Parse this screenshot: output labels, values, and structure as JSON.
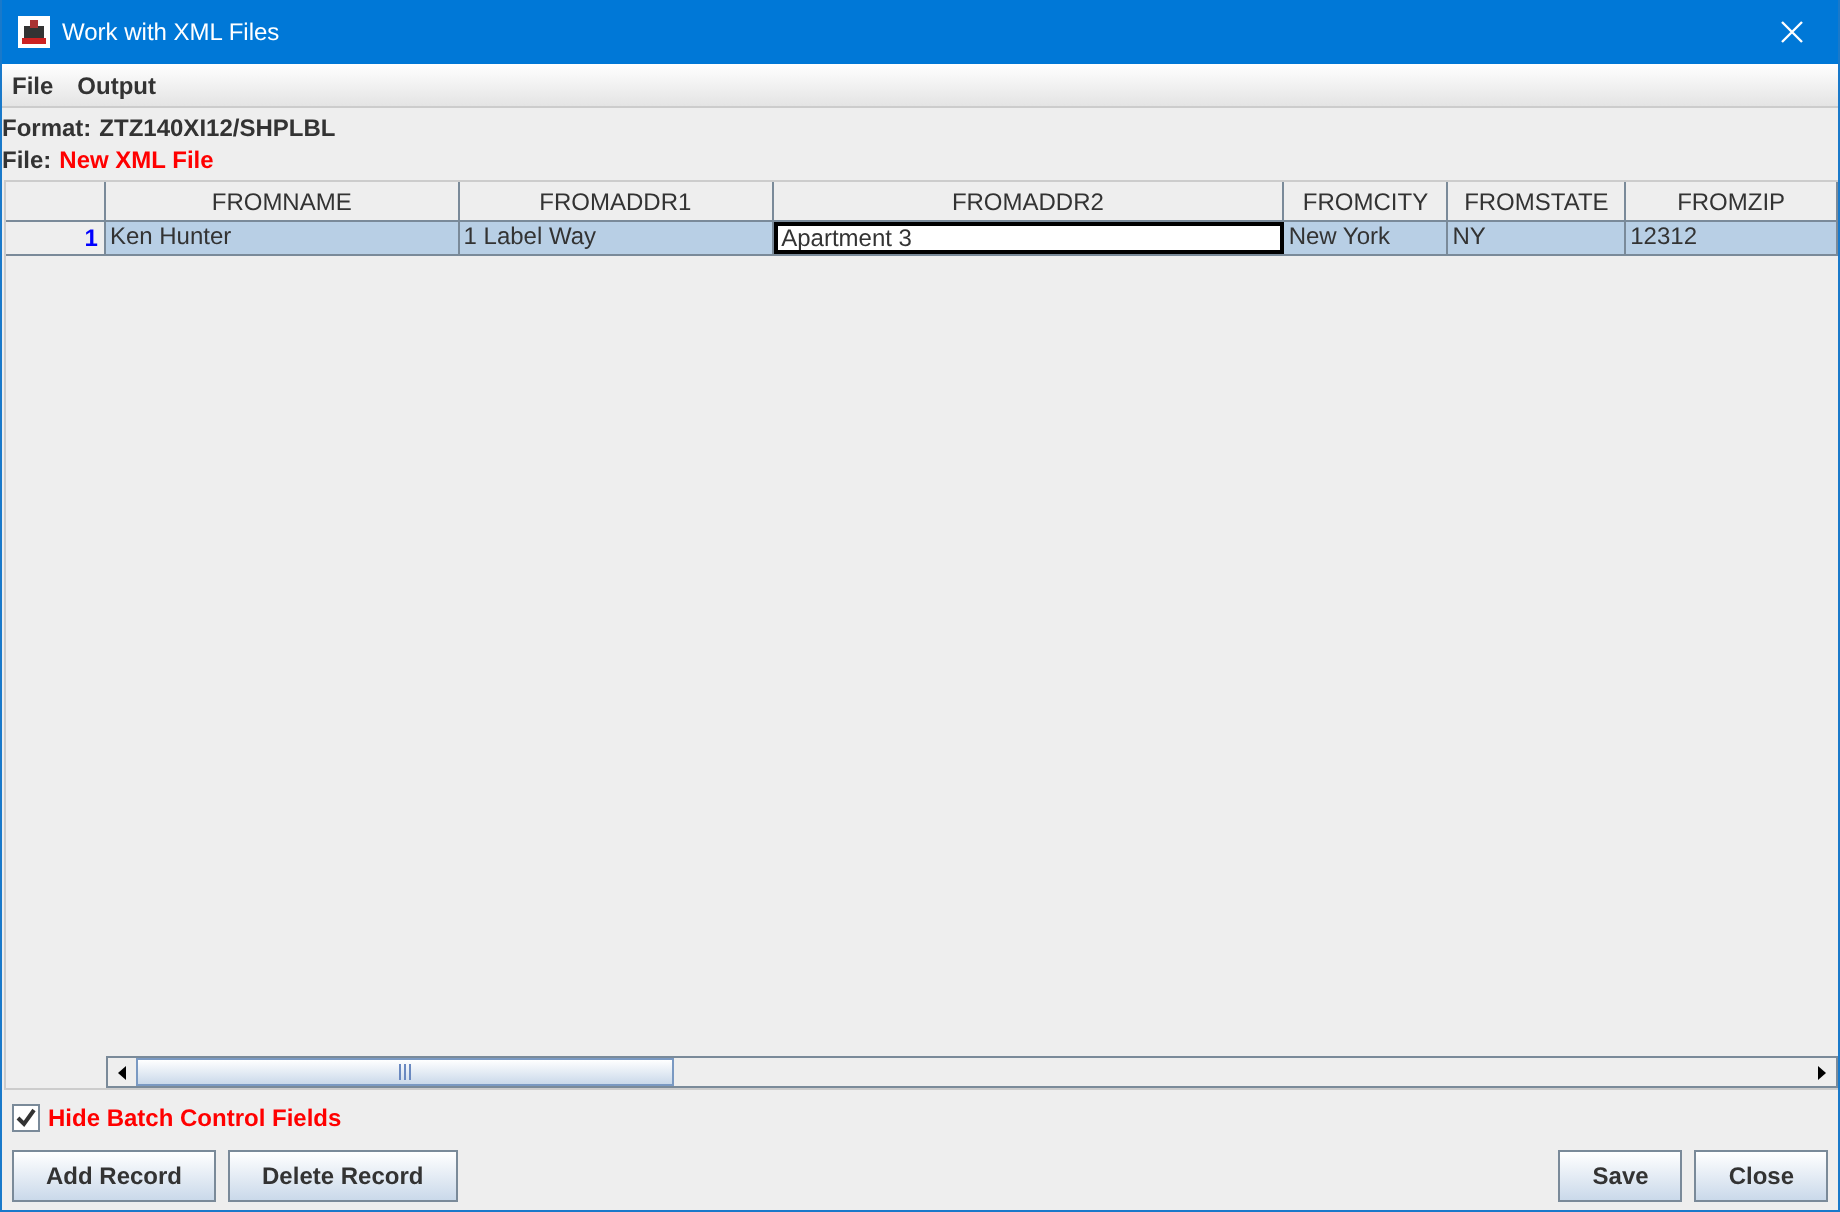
{
  "window": {
    "title": "Work with XML Files"
  },
  "menu": [
    "File",
    "Output"
  ],
  "format": {
    "label": "Format:",
    "value": "ZTZ140XI12/SHPLBL"
  },
  "file": {
    "label": "File:",
    "value": "New XML File"
  },
  "table": {
    "columns": [
      "FROMNAME",
      "FROMADDR1",
      "FROMADDR2",
      "FROMCITY",
      "FROMSTATE",
      "FROMZIP"
    ],
    "rows": [
      {
        "number": "1",
        "selected": true,
        "cells": [
          {
            "value": "Ken Hunter",
            "editing": false
          },
          {
            "value": "1 Label Way",
            "editing": false
          },
          {
            "value": "Apartment 3",
            "editing": true
          },
          {
            "value": "New York",
            "editing": false
          },
          {
            "value": "NY",
            "editing": false
          },
          {
            "value": "12312",
            "editing": false
          }
        ]
      }
    ]
  },
  "hide_batch": {
    "label": "Hide Batch Control Fields",
    "checked": true
  },
  "buttons_left": [
    "Add Record",
    "Delete Record"
  ],
  "buttons_right": [
    "Save",
    "Close"
  ]
}
